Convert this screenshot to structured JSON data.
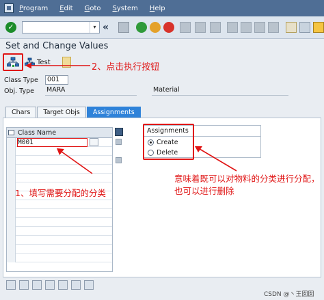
{
  "menu": [
    "Program",
    "Edit",
    "Goto",
    "System",
    "Help"
  ],
  "toolbar": {
    "command_value": "",
    "ok_glyph": "✓",
    "prev_glyph": "«",
    "dropdown_glyph": "▾"
  },
  "page": {
    "title": "Set and Change Values"
  },
  "app_toolbar": {
    "test_label": "Test"
  },
  "fields": {
    "class_type_label": "Class Type",
    "class_type_value": "001",
    "obj_type_label": "Obj. Type",
    "obj_type_value": "MARA",
    "obj_type_desc": "Material"
  },
  "tabs": [
    {
      "label": "Chars",
      "active": false
    },
    {
      "label": "Target Objs",
      "active": false
    },
    {
      "label": "Assignments",
      "active": true
    }
  ],
  "table": {
    "header": "Class Name",
    "rows": [
      "M001",
      "",
      "",
      "",
      "",
      "",
      "",
      "",
      "",
      "",
      "",
      "",
      "",
      ""
    ]
  },
  "assignments": {
    "title": "Assignments",
    "create_label": "Create",
    "delete_label": "Delete",
    "selected": "Create"
  },
  "annotations": {
    "step1": "1、填写需要分配的分类",
    "step2": "2、点击执行按钮",
    "note": "意味着既可以对物料的分类进行分配，也可以进行删除"
  },
  "watermark": "CSDN @丶王囡囡",
  "colors": {
    "annotation": "#e01515",
    "menubar": "#4f6e95",
    "active_tab": "#2e82d9"
  }
}
